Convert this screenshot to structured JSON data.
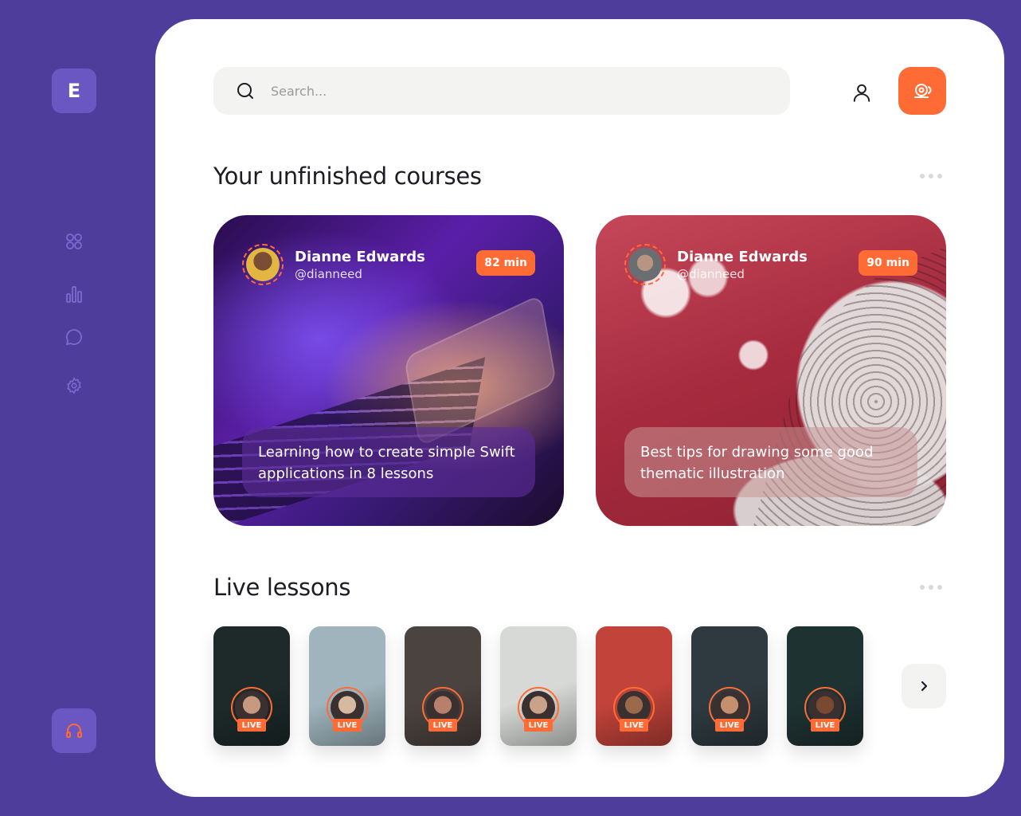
{
  "app": {
    "logo_letter": "E",
    "accent": "#ff6b35",
    "brand": "#4f3d9c"
  },
  "sidebar": {
    "items": [
      {
        "name": "dashboard",
        "icon": "grid-icon"
      },
      {
        "name": "analytics",
        "icon": "bar-chart-icon"
      },
      {
        "name": "messages",
        "icon": "chat-bubble-icon"
      },
      {
        "name": "settings",
        "icon": "gear-icon"
      }
    ],
    "support_icon": "headphones-icon"
  },
  "header": {
    "search_placeholder": "Search...",
    "user_icon": "user-icon",
    "notification_icon": "bell-icon"
  },
  "unfinished": {
    "title": "Your unfinished courses",
    "courses": [
      {
        "author": "Dianne Edwards",
        "handle": "@dianneed",
        "duration": "82 min",
        "caption": "Learning how to create simple Swift applications in 8 lessons"
      },
      {
        "author": "Dianne Edwards",
        "handle": "@dianneed",
        "duration": "90 min",
        "caption": "Best tips for drawing some good thematic illustration"
      }
    ]
  },
  "live": {
    "title": "Live lessons",
    "badge": "LIVE",
    "lessons": [
      {
        "bg": "#1e2a2a",
        "face": "#c79a80"
      },
      {
        "bg": "#9fb4bd",
        "face": "#d7b8a0"
      },
      {
        "bg": "#4b4340",
        "face": "#b8806a"
      },
      {
        "bg": "#d6d9d6",
        "face": "#c9a28a"
      },
      {
        "bg": "#c2433a",
        "face": "#9a6a4a"
      },
      {
        "bg": "#2f3a40",
        "face": "#c4906e"
      },
      {
        "bg": "#1f3232",
        "face": "#7a4a30"
      }
    ]
  }
}
